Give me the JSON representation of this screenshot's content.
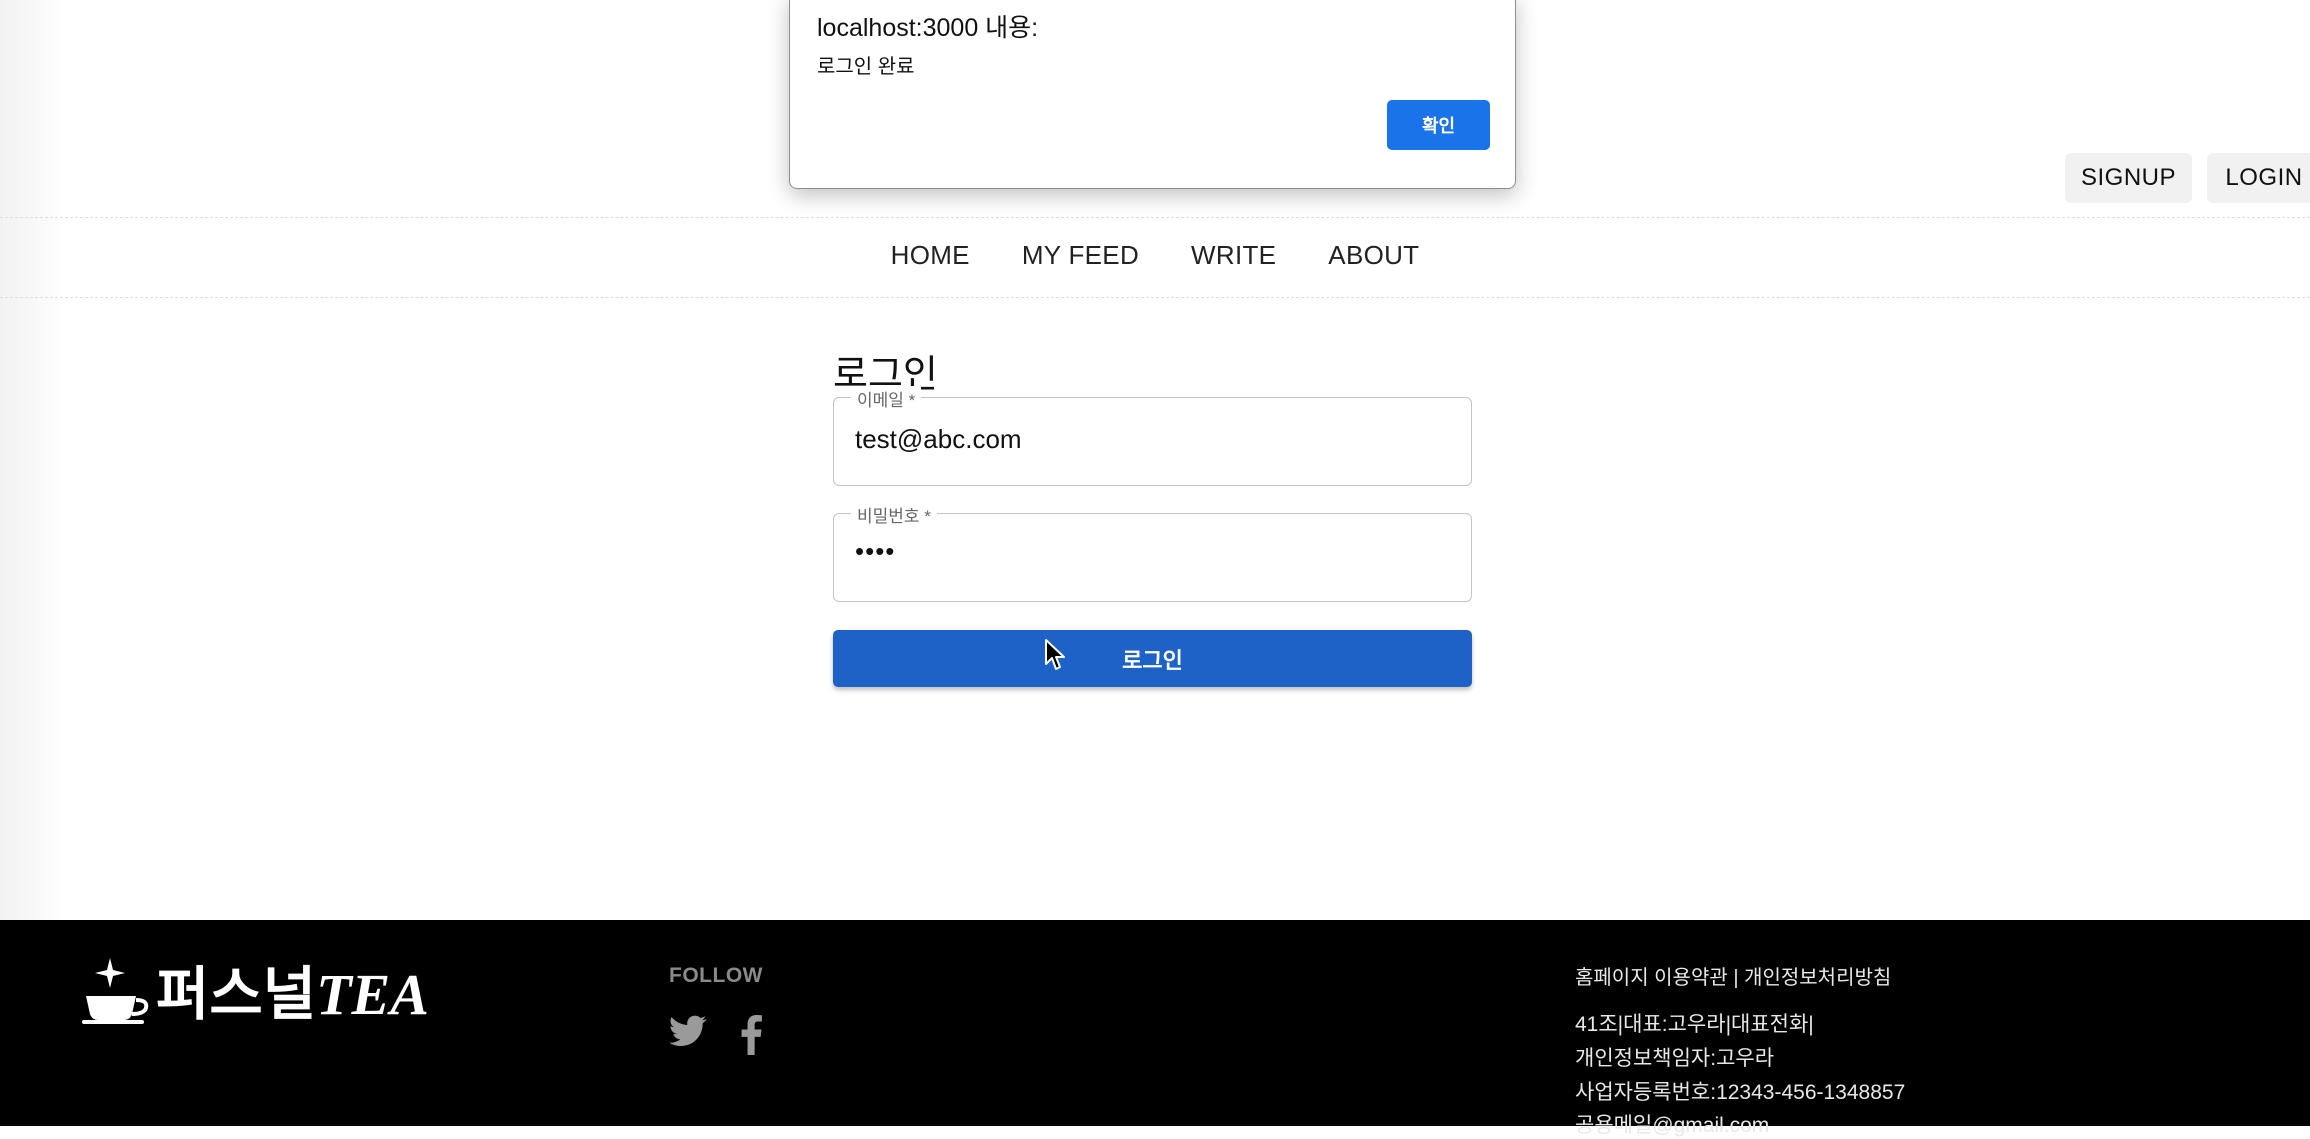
{
  "alert": {
    "title": "localhost:3000 내용:",
    "message": "로그인 완료",
    "ok_label": "확인",
    "accent": "#1a73e8"
  },
  "header": {
    "signup_label": "SIGNUP",
    "login_label": "LOGIN"
  },
  "nav": {
    "items": [
      {
        "label": "HOME"
      },
      {
        "label": "MY FEED"
      },
      {
        "label": "WRITE"
      },
      {
        "label": "ABOUT"
      }
    ]
  },
  "login_form": {
    "title": "로그인",
    "email_label": "이메일 *",
    "email_value": "test@abc.com",
    "password_label": "비밀번호 *",
    "password_value": "••••",
    "submit_label": "로그인",
    "submit_color": "#1e62c7"
  },
  "footer": {
    "logo_text": "퍼스널",
    "logo_tea": "TEA",
    "follow_label": "FOLLOW",
    "social_icons": [
      "twitter-icon",
      "facebook-icon"
    ],
    "links": {
      "terms": "홈페이지 이용약관",
      "separator": " | ",
      "privacy": "개인정보처리방침"
    },
    "info": [
      "41조|대표:고우라|대표전화|",
      "개인정보책임자:고우라",
      "사업자등록번호:12343-456-1348857",
      "공용메일@gmail.com"
    ]
  }
}
